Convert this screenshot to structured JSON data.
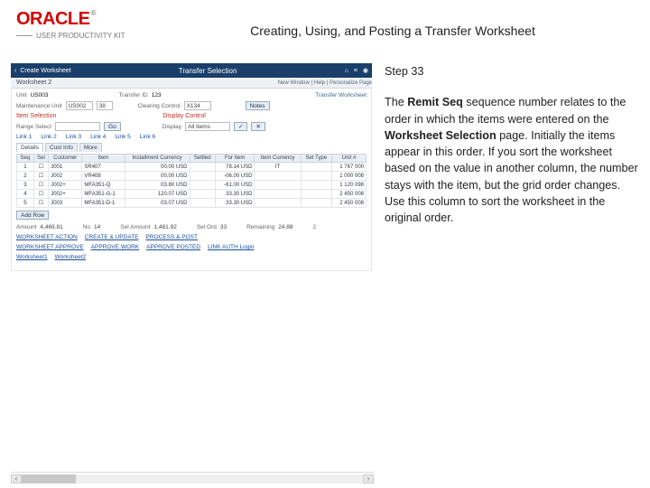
{
  "header": {
    "brand": "ORACLE",
    "tm": "®",
    "upk": "USER PRODUCTIVITY KIT",
    "doc_title": "Creating, Using, and Posting a Transfer Worksheet"
  },
  "side": {
    "step": "Step 33",
    "p1a": "The ",
    "p1b": "Remit Seq",
    "p1c": " sequence number relates to the order in which the items were entered on the ",
    "p1d": "Worksheet Selection",
    "p1e": " page. Initially the items appear in this order. If you sort the worksheet based on the value in another column, the number stays with the item, but the grid order changes. Use this column to sort the worksheet in the original order."
  },
  "app": {
    "back": "‹",
    "back_label": "Create Worksheet",
    "title": "Transfer Selection",
    "tab1": "Worksheet 2",
    "right_meta": "New Window | Help | Personalize Page",
    "row1": {
      "unit_lbl": "Unit",
      "unit": "US003",
      "tid_lbl": "Transfer ID",
      "tid": "123",
      "status": "Transfer Worksheet"
    },
    "row2": {
      "mb_lbl": "Maintenance Unit",
      "mb": "US002",
      "mb2": "38",
      "cc_lbl": "Clearing Control",
      "cc": "X134",
      "notes": "Notes"
    },
    "section1": "Item Selection",
    "section2": "Display Control",
    "row3": {
      "rs_lbl": "Range Select",
      "go": "Go",
      "disp_lbl": "Display",
      "disp": "All Items"
    },
    "linkhdr": {
      "a": "Link 1",
      "b": "Link 2",
      "c": "Link 3",
      "d": "Link 4",
      "e": "Link 5",
      "f": "Link 6"
    },
    "tabs": {
      "details": "Details",
      "custinfo": "Cust Info",
      "more": "More"
    },
    "gridhdr": {
      "seq": "Seq",
      "sel": "Sel",
      "cust": "Customer",
      "item": "Item",
      "inst": "Installment Currency",
      "settled": "Settled",
      "foritem": "For Item",
      "itemcur": "Item Currency",
      "settype": "Set Type",
      "unita": "Unit #"
    },
    "rows": [
      {
        "seq": "1",
        "cust": "J001",
        "item": "SR407",
        "inst": "00.00 USD",
        "foritem": "78.14 USD",
        "itemcur": "IT",
        "unit": "1 767 000"
      },
      {
        "seq": "2",
        "cust": "J002",
        "item": "VR408",
        "inst": "00.00 USD",
        "foritem": "-06.00 USD",
        "itemcur": "",
        "unit": "1 000 008"
      },
      {
        "seq": "3",
        "cust": "J002+",
        "item": "MFA351-Q",
        "inst": "03.80 USD",
        "foritem": "-61.00 USD",
        "itemcur": "",
        "unit": "1 120 098"
      },
      {
        "seq": "4",
        "cust": "J002+",
        "item": "MFA351-G-1",
        "inst": "120.07 USD",
        "foritem": "33.30 USD",
        "itemcur": "",
        "unit": "2 450 008"
      },
      {
        "seq": "5",
        "cust": "J003",
        "item": "MFA351-D-1",
        "inst": "03.07 USD",
        "foritem": "33.30 USD",
        "itemcur": "",
        "unit": "2 450 008"
      }
    ],
    "addrow": "Add Row",
    "totals": {
      "amt_lbl": "Amount",
      "amt": "4,469.81",
      "no_lbl": "No",
      "no": "14",
      "sa_lbl": "Sel Amount",
      "sa": "1,481.92",
      "so_lbl": "Sel Ord",
      "so": "33",
      "rem_lbl": "Remaining",
      "rem": "24.88",
      "c_lbl": "",
      "c": "2"
    },
    "links": {
      "a": "WORKSHEET ACTION",
      "b": "CREATE & UPDATE",
      "c": "PROCESS & POST"
    },
    "links2": {
      "a": "WORKSHEET APPROVE",
      "b": "APPROVE WORK",
      "c": "APPROVE POSTED",
      "d": "LINK AUTH Login"
    },
    "footlinks": {
      "a": "Worksheet1",
      "b": "Worksheet2"
    }
  },
  "icons": {
    "home": "⌂",
    "menu": "≡",
    "user": "◉"
  }
}
